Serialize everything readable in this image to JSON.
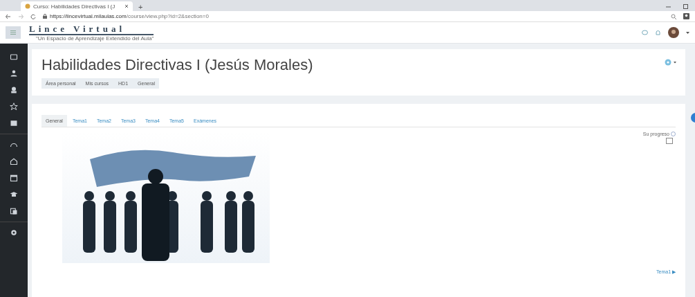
{
  "browser": {
    "tab_title": "Curso: Habilidades Directivas I (J",
    "new_tab": "+",
    "url_host": "https://lincevirtual.milaulas.com",
    "url_path": "/course/view.php?id=2&section=0"
  },
  "navbar": {
    "logo": "Lince Virtual",
    "tagline": "\"Un Espacio de Aprendizaje Extendido del Aula\""
  },
  "sidebar": {
    "items": [
      {
        "kind": "folder",
        "selected": false
      },
      {
        "kind": "users",
        "selected": false
      },
      {
        "kind": "badge",
        "selected": false
      },
      {
        "kind": "star",
        "selected": false
      },
      {
        "kind": "book",
        "selected": false
      },
      {
        "kind": "gauge",
        "selected": false
      },
      {
        "kind": "home",
        "selected": false
      },
      {
        "kind": "calendar",
        "selected": false
      },
      {
        "kind": "cap",
        "selected": false
      },
      {
        "kind": "files",
        "selected": false
      },
      {
        "kind": "gear",
        "selected": false
      }
    ]
  },
  "header": {
    "title": "Habilidades Directivas I (Jesús Morales)",
    "breadcrumbs": [
      "Área personal",
      "Mis cursos",
      "HD1",
      "General"
    ]
  },
  "tabs": [
    {
      "label": "General",
      "selected": true
    },
    {
      "label": "Tema1",
      "selected": false
    },
    {
      "label": "Tema2",
      "selected": false
    },
    {
      "label": "Tema3",
      "selected": false
    },
    {
      "label": "Tema4",
      "selected": false
    },
    {
      "label": "Tema5",
      "selected": false
    },
    {
      "label": "Exámenes",
      "selected": false
    }
  ],
  "progress": {
    "label": "Su progreso",
    "checked": false
  },
  "next_link": "Tema1 ▶"
}
